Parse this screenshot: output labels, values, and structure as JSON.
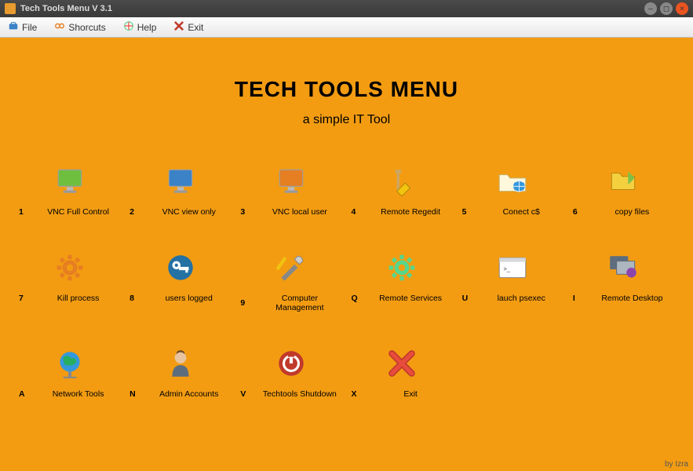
{
  "window": {
    "title": "Tech Tools Menu V 3.1"
  },
  "menubar": {
    "file": "File",
    "shortcuts": "Shorcuts",
    "help": "Help",
    "exit": "Exit"
  },
  "header": {
    "title": "TECH TOOLS MENU",
    "subtitle": "a simple IT Tool"
  },
  "tools": [
    {
      "key": "1",
      "label": "VNC Full Control",
      "icon": "monitor-green"
    },
    {
      "key": "2",
      "label": "VNC view only",
      "icon": "monitor-blue"
    },
    {
      "key": "3",
      "label": "VNC local user",
      "icon": "monitor-orange"
    },
    {
      "key": "4",
      "label": "Remote Regedit",
      "icon": "regedit"
    },
    {
      "key": "5",
      "label": "Conect c$",
      "icon": "folder-globe"
    },
    {
      "key": "6",
      "label": "copy files",
      "icon": "folder-copy"
    },
    {
      "key": "7",
      "label": "Kill process",
      "icon": "gear-orange"
    },
    {
      "key": "8",
      "label": "users logged",
      "icon": "key-blue"
    },
    {
      "key": "9",
      "label": "Computer Management",
      "icon": "screwdriver-wrench"
    },
    {
      "key": "Q",
      "label": "Remote Services",
      "icon": "gear-green"
    },
    {
      "key": "U",
      "label": "lauch psexec",
      "icon": "terminal"
    },
    {
      "key": "I",
      "label": "Remote Desktop",
      "icon": "monitors-globe"
    },
    {
      "key": "A",
      "label": "Network Tools",
      "icon": "globe-green"
    },
    {
      "key": "N",
      "label": "Admin  Accounts",
      "icon": "user"
    },
    {
      "key": "V",
      "label": "Techtools Shutdown",
      "icon": "power-red"
    },
    {
      "key": "X",
      "label": "Exit",
      "icon": "x-red"
    }
  ],
  "footer": {
    "credit": "by Izra"
  }
}
